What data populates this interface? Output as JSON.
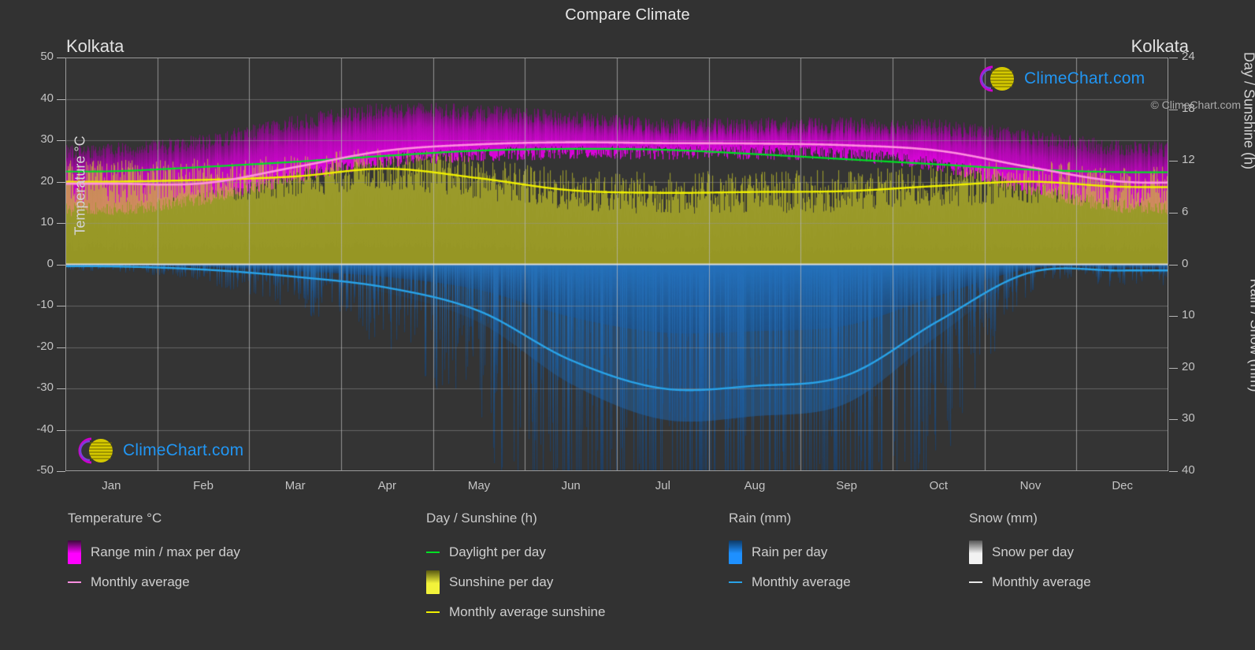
{
  "header": {
    "title": "Compare Climate",
    "city_left": "Kolkata",
    "city_right": "Kolkata"
  },
  "logo": {
    "text": "ClimeChart.com",
    "arc_color": "#cc00cc",
    "sphere_color": "#d4d400",
    "text_color": "#2196f3"
  },
  "footer": {
    "copyright": "© ClimeChart.com"
  },
  "axes": {
    "left_title": "Temperature °C",
    "right_title_top": "Day / Sunshine (h)",
    "right_title_bottom": "Rain / Snow (mm)",
    "left_ticks": [
      "50",
      "40",
      "30",
      "20",
      "10",
      "0",
      "-10",
      "-20",
      "-30",
      "-40",
      "-50"
    ],
    "right_ticks_top": [
      "24",
      "18",
      "12",
      "6",
      "0"
    ],
    "right_ticks_bottom": [
      "0",
      "10",
      "20",
      "30",
      "40"
    ],
    "x_ticks": [
      "Jan",
      "Feb",
      "Mar",
      "Apr",
      "May",
      "Jun",
      "Jul",
      "Aug",
      "Sep",
      "Oct",
      "Nov",
      "Dec"
    ]
  },
  "legend": {
    "columns": [
      {
        "title": "Temperature °C",
        "items": [
          {
            "label": "Range min / max per day",
            "kind": "swatch",
            "color": "#ff00ff",
            "color2": "#3a0a3a"
          },
          {
            "label": "Monthly average",
            "kind": "line",
            "color": "#ff8fe0"
          }
        ]
      },
      {
        "title": "Day / Sunshine (h)",
        "items": [
          {
            "label": "Daylight per day",
            "kind": "line",
            "color": "#00e024"
          },
          {
            "label": "Sunshine per day",
            "kind": "swatch",
            "color": "#f2f23a",
            "color2": "#5a5a12"
          },
          {
            "label": "Monthly average sunshine",
            "kind": "line",
            "color": "#f0f000"
          }
        ]
      },
      {
        "title": "Rain (mm)",
        "items": [
          {
            "label": "Rain per day",
            "kind": "swatch",
            "color": "#1e90ff",
            "color2": "#0d3a66"
          },
          {
            "label": "Monthly average",
            "kind": "line",
            "color": "#29a3e8"
          }
        ]
      },
      {
        "title": "Snow (mm)",
        "items": [
          {
            "label": "Snow per day",
            "kind": "swatch",
            "color": "#f2f2f2",
            "color2": "#555555"
          },
          {
            "label": "Monthly average",
            "kind": "line",
            "color": "#e8e8e8"
          }
        ]
      }
    ]
  },
  "chart_data": {
    "type": "area",
    "title": "Compare Climate",
    "subtitle": "Kolkata",
    "xlabel": "",
    "ylabel": "Temperature °C",
    "ylim": [
      -50,
      50
    ],
    "right_axis_top": {
      "label": "Day / Sunshine (h)",
      "range": [
        0,
        24
      ]
    },
    "right_axis_bottom": {
      "label": "Rain / Snow (mm)",
      "range": [
        0,
        40
      ]
    },
    "grid": true,
    "legend_position": "bottom",
    "categories": [
      "Jan",
      "Feb",
      "Mar",
      "Apr",
      "May",
      "Jun",
      "Jul",
      "Aug",
      "Sep",
      "Oct",
      "Nov",
      "Dec"
    ],
    "series": [
      {
        "name": "Monthly average temperature (°C)",
        "color": "#ff8fe0",
        "axis": "left",
        "values": [
          19.5,
          19.6,
          23.5,
          27.5,
          29.0,
          29.5,
          29.3,
          29.2,
          28.8,
          27.5,
          23.5,
          20.0
        ]
      },
      {
        "name": "Daily max temperature (°C)",
        "color": "#ff00ff",
        "axis": "left",
        "values": [
          27.0,
          29.0,
          33.5,
          36.5,
          36.0,
          34.5,
          33.0,
          33.0,
          33.0,
          32.5,
          30.0,
          27.5
        ]
      },
      {
        "name": "Daily min temperature (°C)",
        "color": "#ff00ff",
        "axis": "left",
        "values": [
          13.5,
          16.0,
          21.0,
          25.0,
          26.5,
          27.0,
          27.0,
          27.0,
          26.5,
          24.0,
          18.5,
          14.0
        ]
      },
      {
        "name": "Daylight per day (h)",
        "color": "#00e024",
        "axis": "right_top",
        "values": [
          10.8,
          11.3,
          11.9,
          12.6,
          13.2,
          13.4,
          13.3,
          12.8,
          12.2,
          11.6,
          11.0,
          10.7
        ]
      },
      {
        "name": "Monthly average sunshine (h)",
        "color": "#f0f000",
        "axis": "right_top",
        "values": [
          9.6,
          9.8,
          10.2,
          11.1,
          10.0,
          8.6,
          8.3,
          8.4,
          8.5,
          9.1,
          9.6,
          9.0
        ]
      },
      {
        "name": "Monthly average rain (mm)",
        "color": "#29a3e8",
        "axis": "right_bottom",
        "values": [
          0.4,
          1.0,
          2.4,
          4.5,
          9.0,
          18.5,
          24.0,
          23.5,
          21.5,
          11.0,
          1.6,
          1.2
        ]
      },
      {
        "name": "Monthly average snow (mm)",
        "color": "#e8e8e8",
        "axis": "right_bottom",
        "values": [
          0,
          0,
          0,
          0,
          0,
          0,
          0,
          0,
          0,
          0,
          0,
          0
        ]
      }
    ]
  }
}
